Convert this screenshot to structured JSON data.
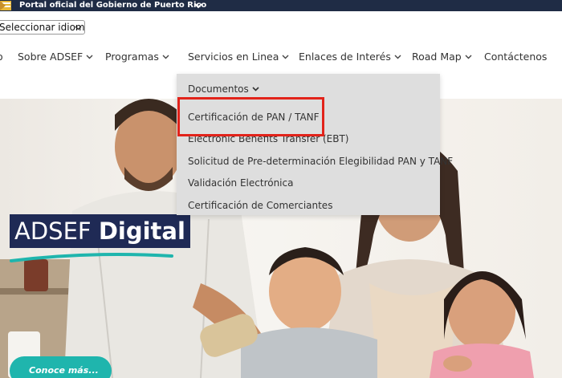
{
  "gov_banner": {
    "text": "Portal oficial del Gobierno de Puerto Rico"
  },
  "language": {
    "selected": "Seleccionar idioma"
  },
  "nav": {
    "items": [
      {
        "label": "o"
      },
      {
        "label": "Sobre ADSEF"
      },
      {
        "label": "Programas"
      },
      {
        "label": "Servicios en Linea"
      },
      {
        "label": "Enlaces de Interés"
      },
      {
        "label": "Road Map"
      },
      {
        "label": "Contáctenos"
      }
    ]
  },
  "dropdown": {
    "items": [
      {
        "label": "Documentos"
      },
      {
        "label": "Certificación de PAN / TANF"
      },
      {
        "label": "Electronic Benefits Transfer (EBT)"
      },
      {
        "label": "Solicitud de Pre-determinación Elegibilidad PAN y TANF"
      },
      {
        "label": "Validación Electrónica"
      },
      {
        "label": "Certificación de Comerciantes"
      }
    ]
  },
  "hero": {
    "brand_light": "ADSEF",
    "brand_bold": "Digital",
    "cta": "Conoce más..."
  },
  "colors": {
    "banner": "#1f2c45",
    "brand_badge": "#1f2a55",
    "accent_teal": "#1fb5ad",
    "highlight_red": "#e2231a"
  }
}
